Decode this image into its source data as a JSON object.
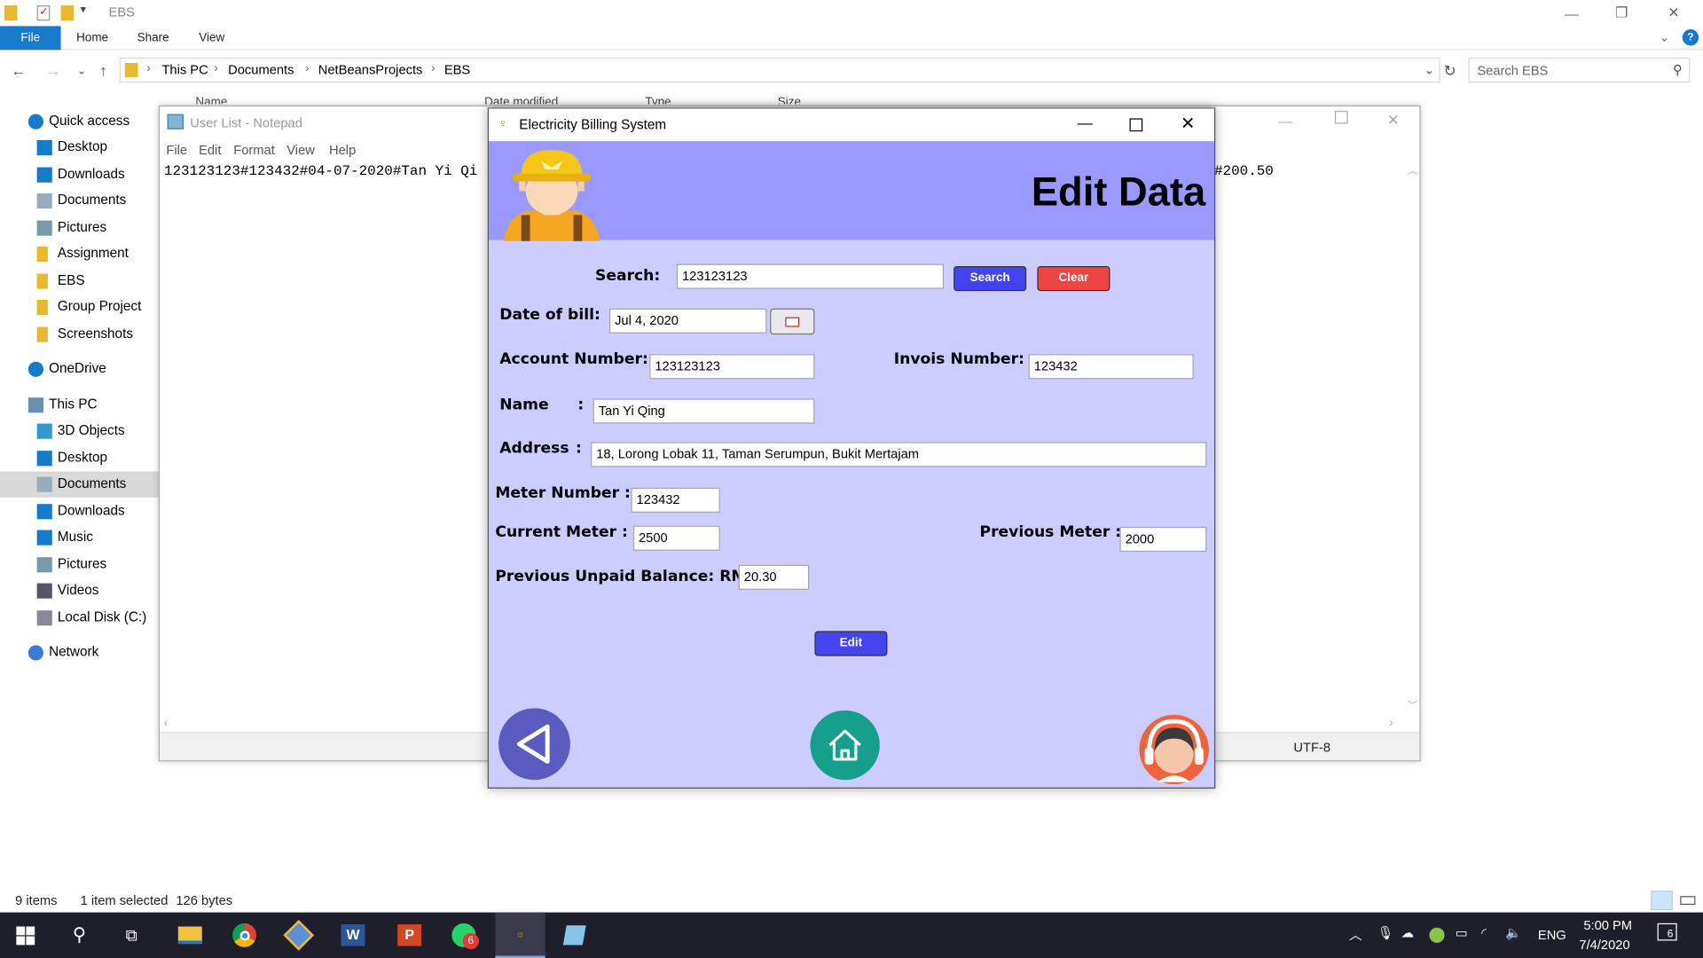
{
  "explorer": {
    "title": "EBS",
    "ribbon_tabs": [
      "File",
      "Home",
      "Share",
      "View"
    ],
    "breadcrumb": [
      "This PC",
      "Documents",
      "NetBeansProjects",
      "EBS"
    ],
    "search_placeholder": "Search EBS",
    "column_headers": [
      "Name",
      "Date modified",
      "Type",
      "Size"
    ],
    "nav_items": [
      {
        "label": "Quick access",
        "icon": "star-icon"
      },
      {
        "label": "Desktop",
        "icon": "desktop-icon"
      },
      {
        "label": "Downloads",
        "icon": "download-icon"
      },
      {
        "label": "Documents",
        "icon": "document-icon"
      },
      {
        "label": "Pictures",
        "icon": "pictures-icon"
      },
      {
        "label": "Assignment",
        "icon": "folder-icon"
      },
      {
        "label": "EBS",
        "icon": "folder-icon"
      },
      {
        "label": "Group Project",
        "icon": "folder-icon"
      },
      {
        "label": "Screenshots",
        "icon": "folder-icon"
      },
      {
        "label": "OneDrive",
        "icon": "cloud-icon"
      },
      {
        "label": "This PC",
        "icon": "computer-icon"
      },
      {
        "label": "3D Objects",
        "icon": "cube-icon"
      },
      {
        "label": "Desktop",
        "icon": "desktop-icon"
      },
      {
        "label": "Documents",
        "icon": "document-icon"
      },
      {
        "label": "Downloads",
        "icon": "download-icon"
      },
      {
        "label": "Music",
        "icon": "music-icon"
      },
      {
        "label": "Pictures",
        "icon": "pictures-icon"
      },
      {
        "label": "Videos",
        "icon": "video-icon"
      },
      {
        "label": "Local Disk (C:)",
        "icon": "disk-icon"
      },
      {
        "label": "Network",
        "icon": "network-icon"
      }
    ],
    "status_items": "9 items",
    "status_selected": "1 item selected",
    "status_size": "126 bytes"
  },
  "notepad": {
    "title": "User List - Notepad",
    "menu": [
      "File",
      "Edit",
      "Format",
      "View",
      "Help"
    ],
    "text_visible_left": "123123123#123432#04-07-2020#Tan Yi Qi",
    "text_visible_right": "#200.50",
    "encoding": "UTF-8"
  },
  "app": {
    "title": "Electricity Billing System",
    "heading": "Edit Data",
    "search_label": "Search:",
    "search_value": "123123123",
    "search_button": "Search",
    "clear_button": "Clear",
    "date_label": "Date of bill:",
    "date_value": "Jul 4, 2020",
    "account_label": "Account Number:",
    "account_value": "123123123",
    "invoice_label": "Invois Number:",
    "invoice_value": "123432",
    "name_label": "Name",
    "name_colon": ":",
    "name_value": "Tan Yi Qing",
    "address_label": "Address",
    "address_colon": ":",
    "address_value": "18, Lorong Lobak 11, Taman Serumpun, Bukit Mertajam",
    "meter_label": "Meter Number :",
    "meter_value": "123432",
    "current_label": "Current Meter  :",
    "current_value": "2500",
    "previous_label": "Previous Meter :",
    "previous_value": "2000",
    "unpaid_label": "Previous Unpaid Balance: RM",
    "unpaid_value": "20.30",
    "edit_button": "Edit",
    "colors": {
      "banner": "#9999ff",
      "body": "#ccccff",
      "search_btn": "#4444ee",
      "clear_btn": "#ee4444",
      "edit_btn": "#4444ee"
    }
  },
  "taskbar": {
    "whatsapp_badge": "6",
    "language": "ENG",
    "time": "5:00 PM",
    "date": "7/4/2020",
    "notification_count": "6"
  }
}
